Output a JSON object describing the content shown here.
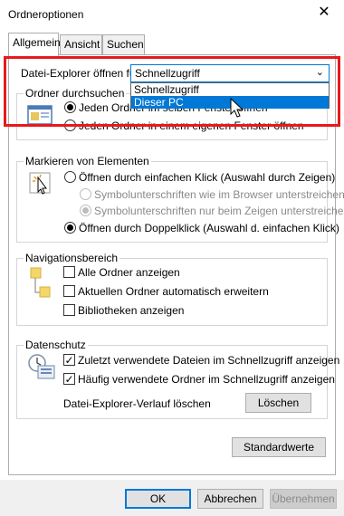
{
  "window": {
    "title": "Ordneroptionen",
    "close_glyph": "✕"
  },
  "tabs": [
    {
      "label": "Allgemein",
      "active": true
    },
    {
      "label": "Ansicht",
      "active": false
    },
    {
      "label": "Suchen",
      "active": false
    }
  ],
  "explorer_open": {
    "label": "Datei-Explorer öffnen für:",
    "selected": "Schnellzugriff",
    "options": [
      "Schnellzugriff",
      "Dieser PC"
    ],
    "highlighted_option": "Dieser PC"
  },
  "browse_folders": {
    "legend": "Ordner durchsuchen",
    "options": [
      {
        "label": "Jeden Ordner im selben Fenster öffnen",
        "checked": true
      },
      {
        "label": "Jeden Ordner in einem eigenen Fenster öffnen",
        "checked": false
      }
    ]
  },
  "click_items": {
    "legend": "Markieren von Elementen",
    "options": [
      {
        "label": "Öffnen durch einfachen Klick (Auswahl durch Zeigen)",
        "checked": false,
        "disabled": false
      },
      {
        "label": "Symbolunterschriften wie im Browser unterstreichen",
        "checked": false,
        "disabled": true
      },
      {
        "label": "Symbolunterschriften nur beim Zeigen unterstreichen",
        "checked": true,
        "disabled": true
      },
      {
        "label": "Öffnen durch Doppelklick (Auswahl d. einfachen Klick)",
        "checked": true,
        "disabled": false
      }
    ]
  },
  "navigation": {
    "legend": "Navigationsbereich",
    "options": [
      {
        "label": "Alle Ordner anzeigen",
        "checked": false
      },
      {
        "label": "Aktuellen Ordner automatisch erweitern",
        "checked": false
      },
      {
        "label": "Bibliotheken anzeigen",
        "checked": false
      }
    ]
  },
  "privacy": {
    "legend": "Datenschutz",
    "options": [
      {
        "label": "Zuletzt verwendete Dateien im Schnellzugriff anzeigen",
        "checked": true
      },
      {
        "label": "Häufig verwendete Ordner im Schnellzugriff anzeigen",
        "checked": true
      }
    ],
    "clear_history_label": "Datei-Explorer-Verlauf löschen",
    "clear_button": "Löschen"
  },
  "restore_defaults_button": "Standardwerte",
  "footer": {
    "ok": "OK",
    "cancel": "Abbrechen",
    "apply": "Übernehmen"
  },
  "colors": {
    "accent": "#0078d7",
    "highlight_border": "#e8191c"
  }
}
